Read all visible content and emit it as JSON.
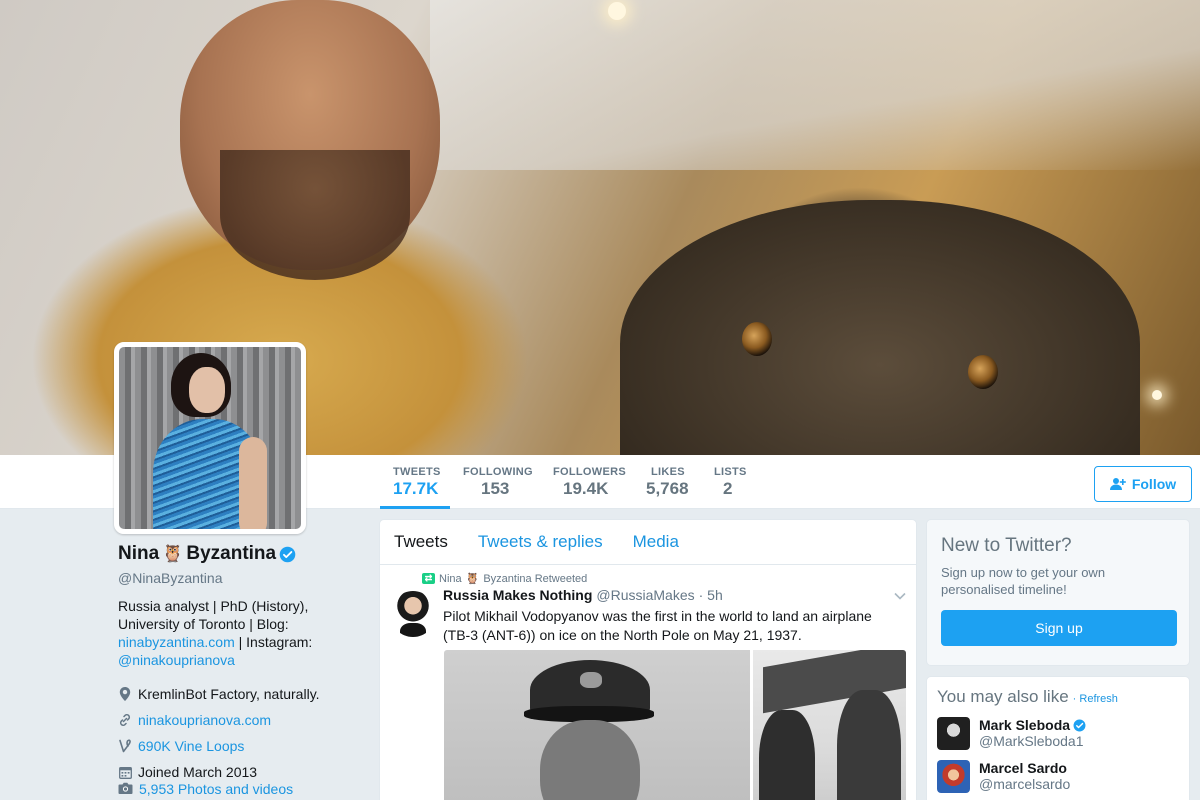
{
  "profile": {
    "name_first": "Nina",
    "name_icon": "owl-emoji",
    "name_last": "Byzantina",
    "handle": "@NinaByzantina",
    "bio_text1": "Russia analyst | PhD (History), University of Toronto | Blog: ",
    "bio_link1": "ninabyzantina.com",
    "bio_text2": " | Instagram: ",
    "bio_link2": "@ninakouprianova",
    "location": "KremlinBot Factory, naturally.",
    "website": "ninakouprianova.com",
    "vine": "690K Vine Loops",
    "joined": "Joined March 2013",
    "photos": "5,953 Photos and videos"
  },
  "stats": [
    {
      "label": "TWEETS",
      "value": "17.7K"
    },
    {
      "label": "FOLLOWING",
      "value": "153"
    },
    {
      "label": "FOLLOWERS",
      "value": "19.4K"
    },
    {
      "label": "LIKES",
      "value": "5,768"
    },
    {
      "label": "LISTS",
      "value": "2"
    }
  ],
  "follow_button": "Follow",
  "timeline": {
    "tabs": [
      "Tweets",
      "Tweets & replies",
      "Media"
    ],
    "tweet": {
      "retweeted_by_first": "Nina",
      "retweeted_by_last": "Byzantina Retweeted",
      "author": "Russia Makes Nothing",
      "handle": "@RussiaMakes",
      "time": "· 5h",
      "text": "Pilot Mikhail Vodopyanov was the first in the world to land an airplane (TB-3 (ANT-6)) on ice on the North Pole on May 21, 1937."
    }
  },
  "signup": {
    "title": "New to Twitter?",
    "text": "Sign up now to get your own personalised timeline!",
    "button": "Sign up"
  },
  "suggestions": {
    "title": "You may also like",
    "refresh": "· Refresh",
    "users": [
      {
        "name": "Mark Sleboda",
        "handle": "@MarkSleboda1",
        "verified": true
      },
      {
        "name": "Marcel Sardo",
        "handle": "@marcelsardo",
        "verified": false
      }
    ]
  },
  "colors": {
    "accent": "#1da1f2",
    "link": "#1b95e0",
    "retweet": "#19cf86"
  }
}
